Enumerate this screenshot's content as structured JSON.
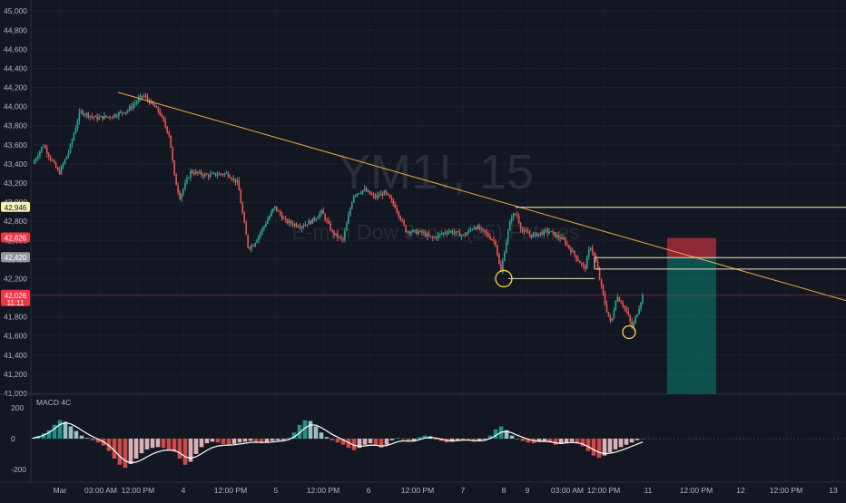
{
  "watermark": {
    "symbol": "YM1!, 15",
    "name": "E-mini Dow Jones ($5) Futures"
  },
  "indicator": {
    "name": "MACD 4C"
  },
  "price_tags": [
    {
      "label": "42,946",
      "color": "#f6f0b8",
      "text_color": "#131722"
    },
    {
      "label": "42,626",
      "color": "#f23645",
      "text_color": "#ffffff"
    },
    {
      "label": "42,420",
      "color": "#9598a1",
      "text_color": "#ffffff"
    },
    {
      "label": "42,026",
      "sub": "11:11",
      "color": "#f23645",
      "text_color": "#ffffff"
    }
  ],
  "colors": {
    "background": "#131722",
    "up": "#26a69a",
    "down": "#ef5350",
    "trendline": "#f0a848",
    "level": "#f6f0b8",
    "stop": "#f23645",
    "target": "#089981"
  },
  "chart_data": [
    {
      "type": "candlestick",
      "title": "YM1!, 15",
      "subtitle": "E-mini Dow Jones ($5) Futures",
      "y_ticks": [
        "41,000",
        "41,200",
        "41,400",
        "41,600",
        "41,800",
        "42,000",
        "42,200",
        "42,400",
        "42,600",
        "42,800",
        "43,000",
        "43,200",
        "43,400",
        "43,600",
        "43,800",
        "44,000",
        "44,200",
        "44,400",
        "44,600",
        "44,800",
        "45,000"
      ],
      "ylim": [
        40990,
        45040
      ],
      "x_ticks": [
        "Mar",
        "03:00 AM",
        "12:00 PM",
        "4",
        "12:00 PM",
        "5",
        "12:00 PM",
        "6",
        "12:00 PM",
        "7",
        "8",
        "9",
        "03:00 AM",
        "12:00 PM",
        "11",
        "12:00 PM",
        "12",
        "12:00 PM",
        "13"
      ],
      "price_path": [
        {
          "t": 0,
          "price": 43400
        },
        {
          "t": 2,
          "price": 43600
        },
        {
          "t": 5,
          "price": 43300
        },
        {
          "t": 7,
          "price": 43550
        },
        {
          "t": 9,
          "price": 43950
        },
        {
          "t": 12,
          "price": 43880
        },
        {
          "t": 15,
          "price": 43900
        },
        {
          "t": 18,
          "price": 43960
        },
        {
          "t": 21,
          "price": 44120
        },
        {
          "t": 24,
          "price": 43950
        },
        {
          "t": 26,
          "price": 43700
        },
        {
          "t": 27,
          "price": 43250
        },
        {
          "t": 28,
          "price": 43050
        },
        {
          "t": 30,
          "price": 43320
        },
        {
          "t": 33,
          "price": 43280
        },
        {
          "t": 37,
          "price": 43300
        },
        {
          "t": 39,
          "price": 43200
        },
        {
          "t": 40,
          "price": 42850
        },
        {
          "t": 41,
          "price": 42520
        },
        {
          "t": 42,
          "price": 42560
        },
        {
          "t": 44,
          "price": 42750
        },
        {
          "t": 46,
          "price": 42950
        },
        {
          "t": 48,
          "price": 42800
        },
        {
          "t": 51,
          "price": 42750
        },
        {
          "t": 53,
          "price": 42800
        },
        {
          "t": 55,
          "price": 42900
        },
        {
          "t": 57,
          "price": 42680
        },
        {
          "t": 59,
          "price": 42600
        },
        {
          "t": 61,
          "price": 43080
        },
        {
          "t": 63,
          "price": 43130
        },
        {
          "t": 65,
          "price": 43050
        },
        {
          "t": 67,
          "price": 43100
        },
        {
          "t": 69,
          "price": 42950
        },
        {
          "t": 71,
          "price": 42700
        },
        {
          "t": 74,
          "price": 42680
        },
        {
          "t": 76,
          "price": 42620
        },
        {
          "t": 79,
          "price": 42700
        },
        {
          "t": 82,
          "price": 42650
        },
        {
          "t": 84,
          "price": 42750
        },
        {
          "t": 86,
          "price": 42680
        },
        {
          "t": 88,
          "price": 42580
        },
        {
          "t": 89,
          "price": 42250
        },
        {
          "t": 90,
          "price": 42580
        },
        {
          "t": 91,
          "price": 42850
        },
        {
          "t": 92,
          "price": 42880
        },
        {
          "t": 93,
          "price": 42700
        },
        {
          "t": 95,
          "price": 42650
        },
        {
          "t": 98,
          "price": 42700
        },
        {
          "t": 101,
          "price": 42600
        },
        {
          "t": 103,
          "price": 42450
        },
        {
          "t": 105,
          "price": 42300
        },
        {
          "t": 106,
          "price": 42550
        },
        {
          "t": 107,
          "price": 42400
        },
        {
          "t": 108,
          "price": 42150
        },
        {
          "t": 109,
          "price": 41900
        },
        {
          "t": 110,
          "price": 41720
        },
        {
          "t": 111,
          "price": 42020
        },
        {
          "t": 112,
          "price": 41950
        },
        {
          "t": 113,
          "price": 41850
        },
        {
          "t": 114,
          "price": 41680
        },
        {
          "t": 115,
          "price": 41850
        },
        {
          "t": 116,
          "price": 42026
        }
      ],
      "levels": [
        42946,
        42420,
        42300,
        42200
      ],
      "position": {
        "entry": 42420,
        "stop": 42626,
        "target": 40990
      },
      "trendline": {
        "from_price": 44150,
        "to_price": 41970
      },
      "marked_lows": [
        42200,
        41640
      ]
    },
    {
      "type": "histogram",
      "title": "MACD 4C",
      "y_ticks": [
        "200",
        "0",
        "-200"
      ],
      "ylim": [
        -260,
        260
      ],
      "values": [
        5,
        18,
        35,
        55,
        90,
        120,
        110,
        80,
        50,
        20,
        5,
        -10,
        -25,
        -45,
        -80,
        -130,
        -170,
        -190,
        -165,
        -130,
        -95,
        -70,
        -60,
        -55,
        -60,
        -70,
        -85,
        -130,
        -170,
        -150,
        -100,
        -55,
        -30,
        -20,
        -25,
        -35,
        -40,
        -35,
        -25,
        -20,
        -15,
        -20,
        -30,
        -25,
        -15,
        -10,
        -8,
        5,
        40,
        90,
        120,
        115,
        80,
        40,
        10,
        -10,
        -25,
        -40,
        -60,
        -75,
        -60,
        -40,
        -30,
        -45,
        -60,
        -40,
        -10,
        5,
        -5,
        -20,
        -15,
        10,
        20,
        15,
        -5,
        -15,
        -25,
        -20,
        -10,
        -5,
        -10,
        -20,
        -15,
        -5,
        20,
        60,
        80,
        55,
        20,
        -5,
        -15,
        -25,
        -30,
        -20,
        -15,
        -25,
        -40,
        -35,
        -25,
        -20,
        -30,
        -50,
        -80,
        -110,
        -125,
        -110,
        -90,
        -70,
        -55,
        -40,
        -25,
        -10,
        0
      ],
      "signal": [
        3,
        10,
        22,
        40,
        65,
        92,
        104,
        96,
        78,
        55,
        33,
        13,
        -3,
        -20,
        -45,
        -78,
        -115,
        -145,
        -158,
        -153,
        -138,
        -118,
        -100,
        -86,
        -77,
        -74,
        -76,
        -93,
        -118,
        -128,
        -118,
        -98,
        -76,
        -58,
        -48,
        -43,
        -42,
        -40,
        -35,
        -30,
        -25,
        -23,
        -25,
        -25,
        -22,
        -18,
        -14,
        -6,
        10,
        38,
        70,
        90,
        88,
        72,
        50,
        28,
        10,
        -8,
        -26,
        -43,
        -50,
        -47,
        -42,
        -43,
        -48,
        -45,
        -33,
        -20,
        -14,
        -16,
        -16,
        -6,
        4,
        8,
        4,
        -3,
        -11,
        -15,
        -13,
        -10,
        -10,
        -13,
        -14,
        -11,
        0,
        20,
        42,
        47,
        38,
        22,
        8,
        -4,
        -13,
        -18,
        -17,
        -20,
        -27,
        -30,
        -28,
        -25,
        -27,
        -35,
        -52,
        -72,
        -90,
        -98,
        -96,
        -88,
        -76,
        -64,
        -50,
        -36,
        -22
      ]
    }
  ]
}
